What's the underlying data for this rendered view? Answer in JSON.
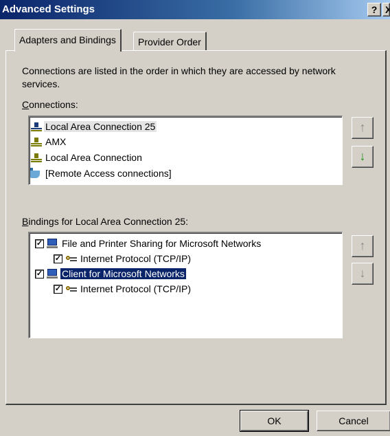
{
  "window": {
    "title": "Advanced Settings",
    "help_label": "?",
    "close_label": "X"
  },
  "tabs": [
    {
      "label": "Adapters and Bindings",
      "active": true
    },
    {
      "label": "Provider Order",
      "active": false
    }
  ],
  "description": "Connections are listed in the order in which they are accessed by network services.",
  "connections": {
    "label_accel": "C",
    "label_rest": "onnections:",
    "items": [
      {
        "label": "Local Area Connection 25",
        "icon": "network-connection-icon",
        "selected": true
      },
      {
        "label": "AMX",
        "icon": "network-connection-icon",
        "selected": false
      },
      {
        "label": "Local Area Connection",
        "icon": "network-connection-icon",
        "selected": false
      },
      {
        "label": "[Remote Access connections]",
        "icon": "remote-access-icon",
        "selected": false
      }
    ]
  },
  "bindings": {
    "label_accel": "B",
    "label_rest": "indings for Local Area Connection 25:",
    "items": [
      {
        "label": "File and Printer Sharing for Microsoft Networks",
        "icon": "file-printer-sharing-icon",
        "checked": true,
        "level": 0,
        "selected": false
      },
      {
        "label": "Internet Protocol (TCP/IP)",
        "icon": "protocol-icon",
        "checked": true,
        "level": 1,
        "selected": false
      },
      {
        "label": "Client for Microsoft Networks",
        "icon": "network-client-icon",
        "checked": true,
        "level": 0,
        "selected": true
      },
      {
        "label": "Internet Protocol (TCP/IP)",
        "icon": "protocol-icon",
        "checked": true,
        "level": 1,
        "selected": false
      }
    ]
  },
  "side_buttons": {
    "up_glyph": "↑",
    "down_glyph": "↓"
  },
  "footer": {
    "ok_label": "OK",
    "cancel_label": "Cancel"
  },
  "check_glyph": "✓"
}
